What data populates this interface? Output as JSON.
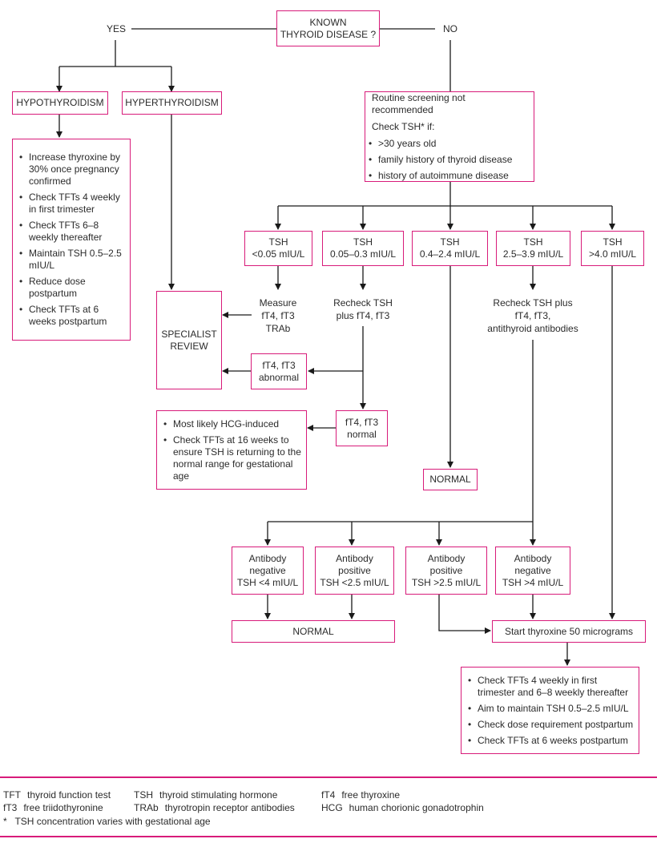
{
  "colors": {
    "box_border": "#d81b7a",
    "line": "#1a1a1a",
    "text": "#2b2b2b"
  },
  "start": {
    "line1": "KNOWN",
    "line2": "THYROID DISEASE ?"
  },
  "branches": {
    "yes": "YES",
    "no": "NO"
  },
  "yes_side": {
    "hypothyroidism": "HYPOTHYROIDISM",
    "hyperthyroidism": "HYPERTHYROIDISM",
    "hypo_actions": [
      "Increase thyroxine by 30% once pregnancy confirmed",
      "Check TFTs 4 weekly in first trimester",
      "Check TFTs 6–8 weekly thereafter",
      "Maintain TSH 0.5–2.5 mIU/L",
      "Reduce dose postpartum",
      "Check TFTs at 6 weeks postpartum"
    ],
    "specialist": {
      "line1": "SPECIALIST",
      "line2": "REVIEW"
    }
  },
  "no_side": {
    "screening": {
      "title": "Routine screening not recommended",
      "check": "Check TSH* if:",
      "criteria": [
        ">30 years old",
        "family history of thyroid disease",
        "history of autoimmune disease"
      ]
    },
    "tsh_levels": [
      {
        "line1": "TSH",
        "line2": "<0.05 mIU/L"
      },
      {
        "line1": "TSH",
        "line2": "0.05–0.3 mIU/L"
      },
      {
        "line1": "TSH",
        "line2": "0.4–2.4 mIU/L"
      },
      {
        "line1": "TSH",
        "line2": "2.5–3.9 mIU/L"
      },
      {
        "line1": "TSH",
        "line2": ">4.0 mIU/L"
      }
    ],
    "measure": {
      "line1": "Measure",
      "line2": "fT4, fT3",
      "line3": "TRAb"
    },
    "recheck1": {
      "line1": "Recheck TSH",
      "line2": "plus fT4, fT3"
    },
    "recheck2": {
      "line1": "Recheck TSH plus",
      "line2": "fT4, fT3,",
      "line3": "antithyroid antibodies"
    },
    "abnormal": {
      "line1": "fT4, fT3",
      "line2": "abnormal"
    },
    "normal_ft": {
      "line1": "fT4, fT3",
      "line2": "normal"
    },
    "hcg_notes": [
      "Most likely HCG-induced",
      "Check TFTs at 16 weeks to ensure TSH is returning to the normal range for gestational age"
    ],
    "normal_label": "NORMAL",
    "antibody": [
      {
        "line1": "Antibody",
        "line2": "negative",
        "line3": "TSH <4 mIU/L"
      },
      {
        "line1": "Antibody",
        "line2": "positive",
        "line3": "TSH <2.5 mIU/L"
      },
      {
        "line1": "Antibody",
        "line2": "positive",
        "line3": "TSH >2.5 mIU/L"
      },
      {
        "line1": "Antibody",
        "line2": "negative",
        "line3": "TSH >4 mIU/L"
      }
    ],
    "normal_bottom": "NORMAL",
    "start_thyroxine": "Start thyroxine 50 micrograms",
    "thyroxine_followup": [
      "Check TFTs 4 weekly in first trimester and 6–8 weekly thereafter",
      "Aim to maintain TSH 0.5–2.5 mIU/L",
      "Check dose requirement postpartum",
      "Check TFTs at 6 weeks postpartum"
    ]
  },
  "legend": {
    "items": [
      {
        "abbr": "TFT",
        "text": "thyroid function test"
      },
      {
        "abbr": "TSH",
        "text": "thyroid stimulating hormone"
      },
      {
        "abbr": "fT4",
        "text": "free thyroxine"
      },
      {
        "abbr": "fT3",
        "text": "free triidothyronine"
      },
      {
        "abbr": "TRAb",
        "text": "thyrotropin receptor antibodies"
      },
      {
        "abbr": "HCG",
        "text": "human chorionic gonadotrophin"
      }
    ],
    "footnote": "*   TSH concentration varies with gestational age"
  }
}
